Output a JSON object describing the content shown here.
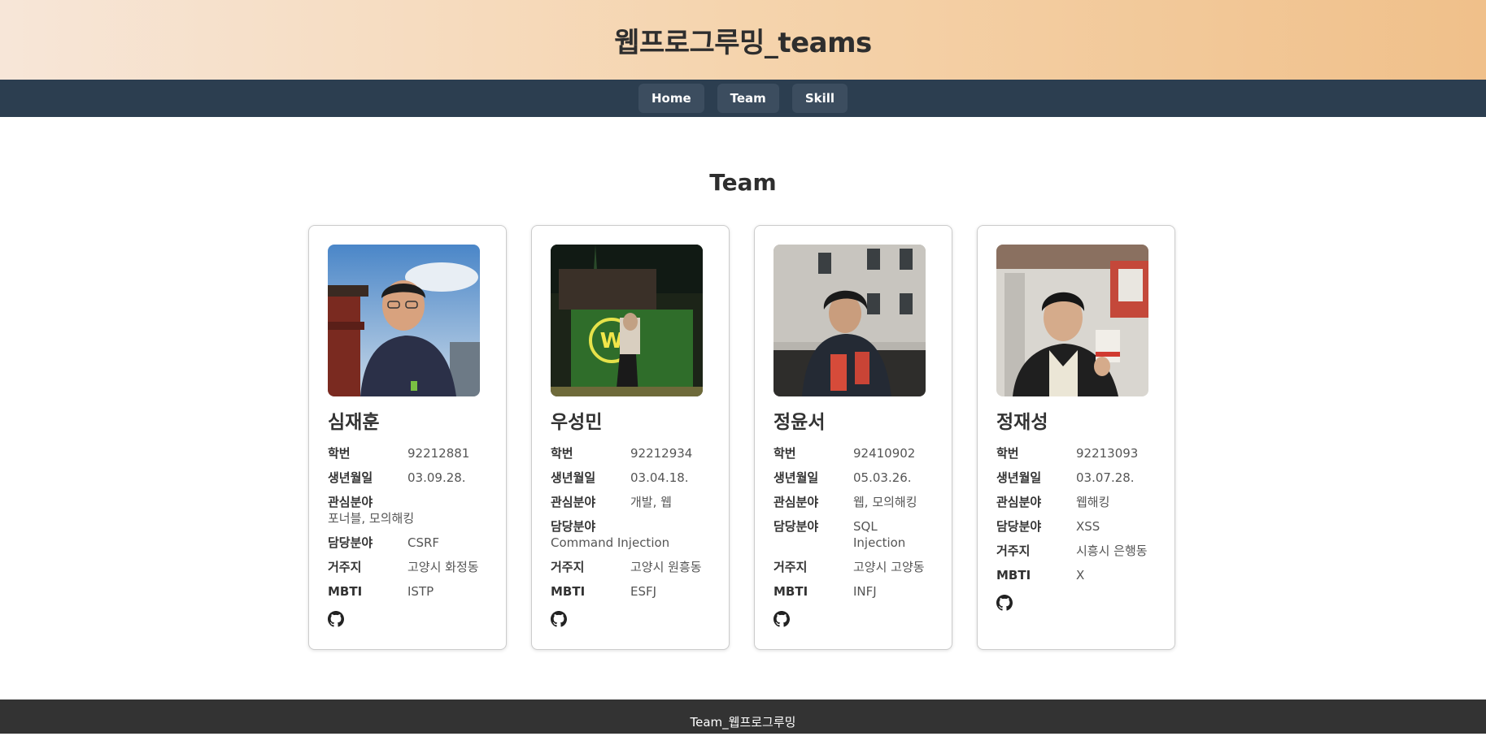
{
  "header": {
    "title": "웹프로그루밍_teams"
  },
  "nav": {
    "home": "Home",
    "team": "Team",
    "skill": "Skill"
  },
  "section": {
    "title": "Team"
  },
  "labels": {
    "student_id": "학번",
    "birth": "생년월일",
    "interest": "관심분야",
    "role": "담당분야",
    "residence": "거주지",
    "mbti": "MBTI"
  },
  "members": [
    {
      "name": "심재훈",
      "student_id": "92212881",
      "birth": "03.09.28.",
      "interest": "포너블, 모의해킹",
      "role": "CSRF",
      "residence": "고양시 화정동",
      "mbti": "ISTP"
    },
    {
      "name": "우성민",
      "student_id": "92212934",
      "birth": "03.04.18.",
      "interest": "개발, 웹",
      "role": "Command Injection",
      "residence": "고양시 원흥동",
      "mbti": "ESFJ"
    },
    {
      "name": "정윤서",
      "student_id": "92410902",
      "birth": "05.03.26.",
      "interest": "웹, 모의해킹",
      "role": "SQL Injection",
      "residence": "고양시 고양동",
      "mbti": "INFJ"
    },
    {
      "name": "정재성",
      "student_id": "92213093",
      "birth": "03.07.28.",
      "interest": "웹해킹",
      "role": "XSS",
      "residence": "시흥시 은행동",
      "mbti": "X"
    }
  ],
  "footer": {
    "text": "Team_웹프로그루밍"
  },
  "icons": {
    "github": "github-icon"
  }
}
